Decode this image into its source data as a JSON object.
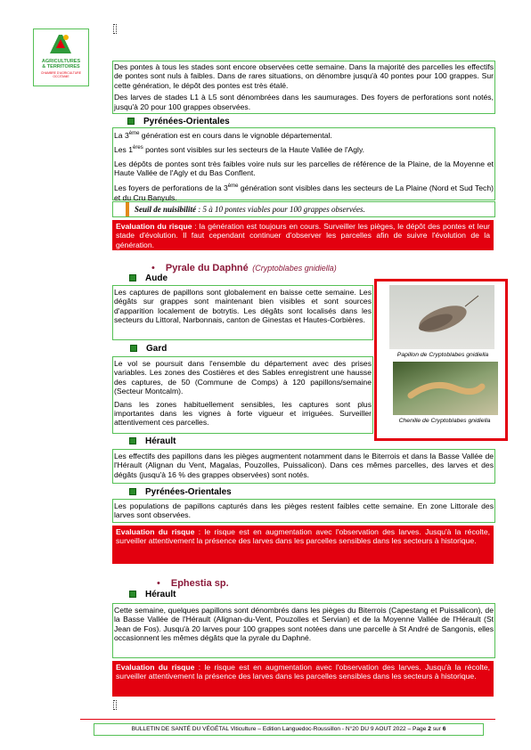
{
  "logo": {
    "line1": "AGRICULTURES",
    "line2": "& TERRITOIRES",
    "line3": "CHAMBRE D'AGRICULTURE",
    "line4": "OCCITANIE"
  },
  "intro": {
    "p1": "Des pontes à tous les stades sont encore observées cette semaine. Dans la majorité des parcelles les effectifs de pontes sont nuls à faibles. Dans de rares situations, on dénombre jusqu'à 40 pontes pour 100 grappes. Sur cette génération, le dépôt des pontes est très étalé.",
    "p2": "Des larves de stades L1 à L5 sont dénombrées dans les saumurages. Des foyers de perforations sont notés, jusqu'à 20 pour 100 grappes observées."
  },
  "po1": {
    "title": "Pyrénées-Orientales",
    "p1_a": "La 3",
    "p1_sup": "ème",
    "p1_b": " génération est en cours dans le vignoble départemental.",
    "p2_a": "Les 1",
    "p2_sup": "ères",
    "p2_b": " pontes sont visibles sur les secteurs de la Haute Vallée de l'Agly.",
    "p3": "Les dépôts de pontes sont très faibles voire nuls sur les parcelles de référence de la Plaine, de la Moyenne et Haute Vallée de l'Agly et du Bas Conflent.",
    "p4_a": "Les foyers de perforations de la 3",
    "p4_sup": "ème",
    "p4_b": " génération sont visibles dans les secteurs de La Plaine (Nord et Sud Tech) et du Cru Banyuls."
  },
  "seuil": {
    "label": "Seuil de nuisibilité",
    "text": " : 5 à 10 pontes viables pour 100 grappes observées."
  },
  "risk1": {
    "label": "Evaluation du risque",
    "text": " : la génération est toujours en cours. Surveiller les pièges, le dépôt des pontes et leur stade d'évolution. Il faut cependant continuer d'observer les parcelles afin de suivre l'évolution de la génération."
  },
  "pyrale": {
    "bullet": "•",
    "title": "Pyrale du Daphné",
    "latin": "(Cryptoblabes gnidiella)"
  },
  "aude": {
    "title": "Aude",
    "p": "Les captures de papillons sont globalement en baisse cette semaine. Les dégâts sur grappes sont maintenant bien visibles et sont sources d'apparition localement de botrytis. Les dégâts sont localisés dans les secteurs du Littoral, Narbonnais, canton de Ginestas et Hautes-Corbières."
  },
  "gard": {
    "title": "Gard",
    "p1": "Le vol se poursuit dans l'ensemble du département avec des prises variables. Les zones des Costières et des Sables enregistrent une hausse des captures, de 50 (Commune de Comps) à 120 papillons/semaine (Secteur Montcalm).",
    "p2": "Dans les zones habituellement sensibles, les captures sont plus importantes dans les vignes à forte vigueur et irriguées. Surveiller attentivement ces parcelles."
  },
  "photos": {
    "cap1": "Papillon de Cryptoblabes gnidiella",
    "cap2": "Chenille de Cryptoblabes gnidiella"
  },
  "herault1": {
    "title": "Hérault",
    "p": "Les effectifs des papillons dans les pièges augmentent notamment dans le Biterrois et dans la Basse Vallée de l'Hérault (Alignan du Vent, Magalas, Pouzolles, Puissalicon). Dans ces mêmes parcelles, des larves et des dégâts (jusqu'à 16 % des grappes observées) sont notés."
  },
  "po2": {
    "title": "Pyrénées-Orientales",
    "p": "Les populations de papillons capturés dans les pièges restent faibles cette semaine. En zone Littorale des larves sont observées."
  },
  "risk2": {
    "label": "Evaluation du risque",
    "text": " : le risque est en augmentation avec l'observation des larves. Jusqu'à la récolte, surveiller attentivement la présence des larves dans les parcelles sensibles dans les secteurs à historique."
  },
  "ephestia": {
    "bullet": "•",
    "title": "Ephestia sp."
  },
  "herault2": {
    "title": "Hérault",
    "p": "Cette semaine, quelques papillons sont dénombrés dans les pièges du Biterrois (Capestang et Puissalicon), de la Basse Vallée de l'Hérault (Alignan-du-Vent, Pouzolles et Servian) et de la Moyenne Vallée de l'Hérault (St Jean de Fos). Jusqu'à 20 larves pour 100 grappes sont notées dans une parcelle à St André de Sangonis, elles occasionnent les mêmes dégâts que la pyrale du Daphné."
  },
  "risk3": {
    "label": "Evaluation du risque",
    "text": " : le risque est en augmentation avec l'observation des larves. Jusqu'à la récolte, surveiller attentivement la présence des larves dans les parcelles sensibles dans les secteurs à historique."
  },
  "footer": {
    "text": "BULLETIN DE SANTÉ DU VÉGÉTAL Viticulture – Edition Languedoc-Roussillon - N°20 DU 9 AOUT 2022 – Page ",
    "page": "2",
    "sep": " sur ",
    "total": "6"
  },
  "colors": {
    "accent": "#8b1a3a",
    "risk": "#e3000f",
    "green": "#55c055"
  }
}
